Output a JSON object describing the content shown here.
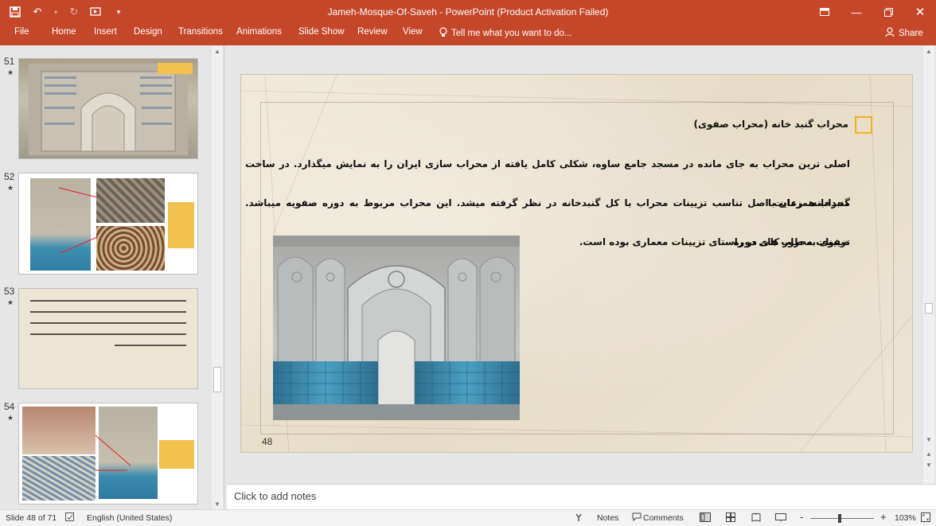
{
  "window": {
    "title": "Jameh-Mosque-Of-Saveh - PowerPoint (Product Activation Failed)"
  },
  "ribbon": {
    "tabs": [
      "File",
      "Home",
      "Insert",
      "Design",
      "Transitions",
      "Animations",
      "Slide Show",
      "Review",
      "View"
    ],
    "tell_me": "Tell me what you want to do...",
    "share": "Share"
  },
  "thumbnails": [
    {
      "number": "51",
      "star": "★"
    },
    {
      "number": "52",
      "star": "★"
    },
    {
      "number": "53",
      "star": "★"
    },
    {
      "number": "54",
      "star": "★"
    }
  ],
  "slide": {
    "heading": "محراب گنبد خانه (محراب صفوی)",
    "lines": [
      "اصلی ترین محراب به جای مانده در مسجد جامع ساوه، شکلی کامل یافته از محراب سازی ایران را به نمایش میگذارد. در ساخت محراب همزمان با",
      "گنبدخانه، رعایت اصل تناسب تزیینات محراب با کل گنبدخانه در نظر گرفته میشد. این محراب مربوط به دوره صفویه میباشد. تزیینات محراب های دوره",
      "صفوی به طور کلی در راستای تزیینات معماری بوده است."
    ],
    "number": "48"
  },
  "notes": {
    "placeholder": "Click to add notes"
  },
  "status": {
    "slide_info": "Slide 48 of 71",
    "language": "English (United States)",
    "notes": "Notes",
    "comments": "Comments",
    "zoom_minus": "-",
    "zoom_plus": "+",
    "zoom": "103%"
  },
  "colors": {
    "accent": "#c5472a",
    "bullet": "#f2b21c"
  }
}
